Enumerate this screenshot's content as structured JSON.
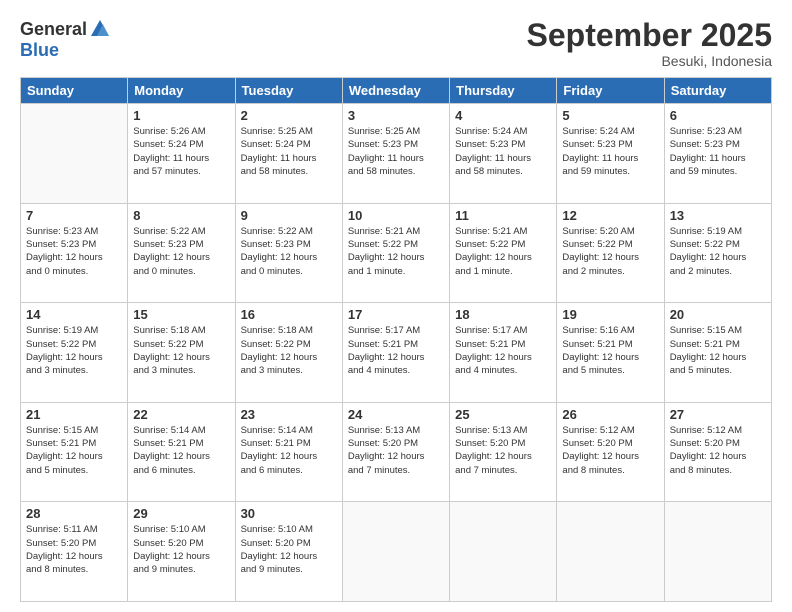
{
  "logo": {
    "general": "General",
    "blue": "Blue"
  },
  "title": "September 2025",
  "location": "Besuki, Indonesia",
  "weekdays": [
    "Sunday",
    "Monday",
    "Tuesday",
    "Wednesday",
    "Thursday",
    "Friday",
    "Saturday"
  ],
  "weeks": [
    [
      null,
      {
        "day": "1",
        "sunrise": "5:26 AM",
        "sunset": "5:24 PM",
        "daylight": "11 hours and 57 minutes."
      },
      {
        "day": "2",
        "sunrise": "5:25 AM",
        "sunset": "5:24 PM",
        "daylight": "11 hours and 58 minutes."
      },
      {
        "day": "3",
        "sunrise": "5:25 AM",
        "sunset": "5:23 PM",
        "daylight": "11 hours and 58 minutes."
      },
      {
        "day": "4",
        "sunrise": "5:24 AM",
        "sunset": "5:23 PM",
        "daylight": "11 hours and 58 minutes."
      },
      {
        "day": "5",
        "sunrise": "5:24 AM",
        "sunset": "5:23 PM",
        "daylight": "11 hours and 59 minutes."
      },
      {
        "day": "6",
        "sunrise": "5:23 AM",
        "sunset": "5:23 PM",
        "daylight": "11 hours and 59 minutes."
      }
    ],
    [
      {
        "day": "7",
        "sunrise": "5:23 AM",
        "sunset": "5:23 PM",
        "daylight": "12 hours and 0 minutes."
      },
      {
        "day": "8",
        "sunrise": "5:22 AM",
        "sunset": "5:23 PM",
        "daylight": "12 hours and 0 minutes."
      },
      {
        "day": "9",
        "sunrise": "5:22 AM",
        "sunset": "5:23 PM",
        "daylight": "12 hours and 0 minutes."
      },
      {
        "day": "10",
        "sunrise": "5:21 AM",
        "sunset": "5:22 PM",
        "daylight": "12 hours and 1 minute."
      },
      {
        "day": "11",
        "sunrise": "5:21 AM",
        "sunset": "5:22 PM",
        "daylight": "12 hours and 1 minute."
      },
      {
        "day": "12",
        "sunrise": "5:20 AM",
        "sunset": "5:22 PM",
        "daylight": "12 hours and 2 minutes."
      },
      {
        "day": "13",
        "sunrise": "5:19 AM",
        "sunset": "5:22 PM",
        "daylight": "12 hours and 2 minutes."
      }
    ],
    [
      {
        "day": "14",
        "sunrise": "5:19 AM",
        "sunset": "5:22 PM",
        "daylight": "12 hours and 3 minutes."
      },
      {
        "day": "15",
        "sunrise": "5:18 AM",
        "sunset": "5:22 PM",
        "daylight": "12 hours and 3 minutes."
      },
      {
        "day": "16",
        "sunrise": "5:18 AM",
        "sunset": "5:22 PM",
        "daylight": "12 hours and 3 minutes."
      },
      {
        "day": "17",
        "sunrise": "5:17 AM",
        "sunset": "5:21 PM",
        "daylight": "12 hours and 4 minutes."
      },
      {
        "day": "18",
        "sunrise": "5:17 AM",
        "sunset": "5:21 PM",
        "daylight": "12 hours and 4 minutes."
      },
      {
        "day": "19",
        "sunrise": "5:16 AM",
        "sunset": "5:21 PM",
        "daylight": "12 hours and 5 minutes."
      },
      {
        "day": "20",
        "sunrise": "5:15 AM",
        "sunset": "5:21 PM",
        "daylight": "12 hours and 5 minutes."
      }
    ],
    [
      {
        "day": "21",
        "sunrise": "5:15 AM",
        "sunset": "5:21 PM",
        "daylight": "12 hours and 5 minutes."
      },
      {
        "day": "22",
        "sunrise": "5:14 AM",
        "sunset": "5:21 PM",
        "daylight": "12 hours and 6 minutes."
      },
      {
        "day": "23",
        "sunrise": "5:14 AM",
        "sunset": "5:21 PM",
        "daylight": "12 hours and 6 minutes."
      },
      {
        "day": "24",
        "sunrise": "5:13 AM",
        "sunset": "5:20 PM",
        "daylight": "12 hours and 7 minutes."
      },
      {
        "day": "25",
        "sunrise": "5:13 AM",
        "sunset": "5:20 PM",
        "daylight": "12 hours and 7 minutes."
      },
      {
        "day": "26",
        "sunrise": "5:12 AM",
        "sunset": "5:20 PM",
        "daylight": "12 hours and 8 minutes."
      },
      {
        "day": "27",
        "sunrise": "5:12 AM",
        "sunset": "5:20 PM",
        "daylight": "12 hours and 8 minutes."
      }
    ],
    [
      {
        "day": "28",
        "sunrise": "5:11 AM",
        "sunset": "5:20 PM",
        "daylight": "12 hours and 8 minutes."
      },
      {
        "day": "29",
        "sunrise": "5:10 AM",
        "sunset": "5:20 PM",
        "daylight": "12 hours and 9 minutes."
      },
      {
        "day": "30",
        "sunrise": "5:10 AM",
        "sunset": "5:20 PM",
        "daylight": "12 hours and 9 minutes."
      },
      null,
      null,
      null,
      null
    ]
  ]
}
